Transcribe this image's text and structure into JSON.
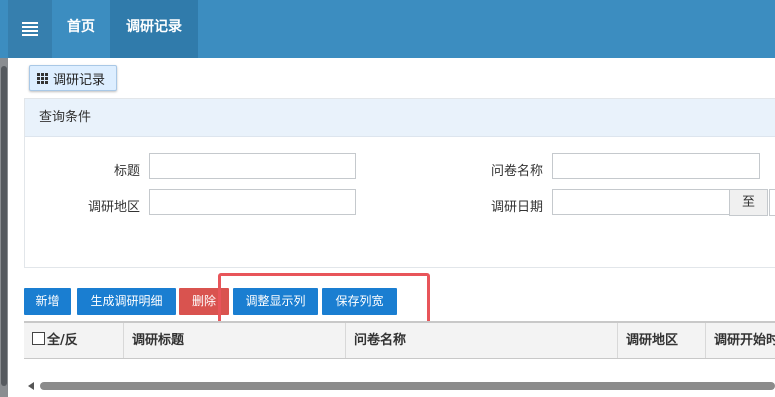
{
  "header": {
    "menu_icon": "hamburger-icon",
    "nav": [
      {
        "label": "首页"
      },
      {
        "label": "调研记录"
      }
    ]
  },
  "page_tab": {
    "icon": "grid-icon",
    "label": "调研记录"
  },
  "query": {
    "title": "查询条件",
    "fields": {
      "title_label": "标题",
      "title_value": "",
      "survey_label": "问卷名称",
      "survey_value": "",
      "region_label": "调研地区",
      "region_value": "",
      "date_label": "调研日期",
      "date_from": "",
      "date_sep": "至"
    }
  },
  "toolbar": {
    "add": "新增",
    "generate": "生成调研明细",
    "delete": "删除",
    "adjust_columns": "调整显示列",
    "save_width": "保存列宽"
  },
  "table": {
    "select_all": "全/反",
    "columns": [
      "调研标题",
      "问卷名称",
      "调研地区",
      "调研开始时间"
    ]
  },
  "colors": {
    "header_bg": "#3c8dc0",
    "button_blue": "#1a7ed1",
    "button_red": "#d9534f",
    "highlight": "#e8555a"
  }
}
